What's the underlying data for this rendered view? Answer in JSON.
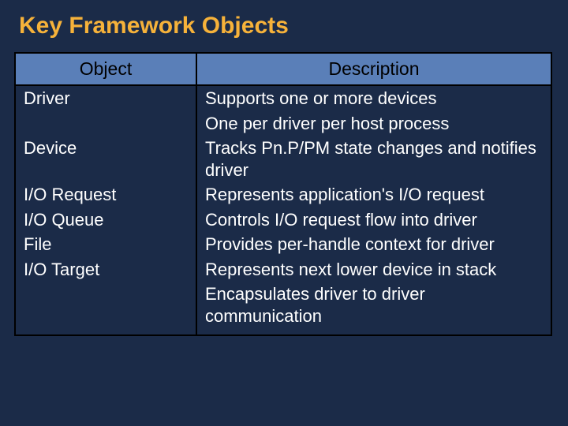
{
  "title": "Key Framework Objects",
  "columns": {
    "object": "Object",
    "description": "Description"
  },
  "rows": [
    {
      "object": "Driver",
      "description": "Supports one or more devices"
    },
    {
      "object": "",
      "description": "One per driver per host process"
    },
    {
      "object": "Device",
      "description": "Tracks Pn.P/PM state changes and notifies driver"
    },
    {
      "object": "I/O Request",
      "description": "Represents application's I/O request"
    },
    {
      "object": "I/O Queue",
      "description": "Controls I/O request flow into driver"
    },
    {
      "object": "File",
      "description": "Provides per-handle context for driver"
    },
    {
      "object": "I/O Target",
      "description": "Represents next lower device in stack"
    },
    {
      "object": "",
      "description": "Encapsulates driver to driver communication"
    }
  ]
}
